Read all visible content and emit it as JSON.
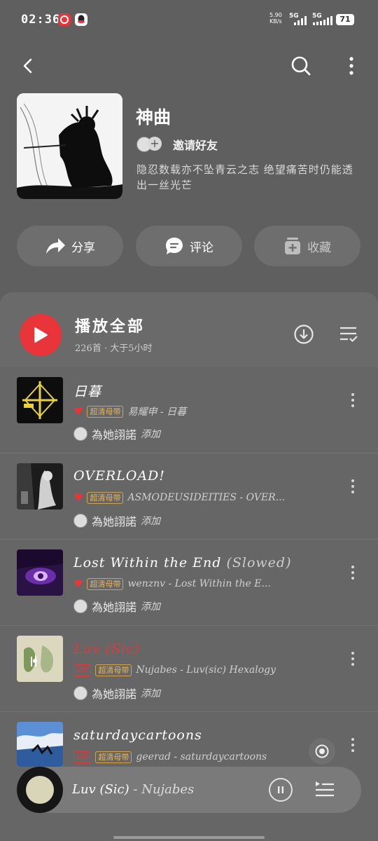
{
  "status_bar": {
    "time": "02:36",
    "net_speed": "5.90",
    "net_unit": "KB/s",
    "sim1": "5G",
    "sim2": "5G",
    "battery": "71"
  },
  "header": {
    "back_icon": "chevron-left-icon",
    "search_icon": "search-icon",
    "more_icon": "more-vertical-icon"
  },
  "playlist": {
    "title": "神曲",
    "invite_label": "邀请好友",
    "description": "隐忍数载亦不坠青云之志 绝望痛苦时仍能透出一丝光芒"
  },
  "actions": [
    {
      "label": "分享",
      "icon": "share-icon"
    },
    {
      "label": "评论",
      "icon": "comment-icon"
    },
    {
      "label": "收藏",
      "icon": "collect-icon"
    }
  ],
  "list_header": {
    "play_all": "播放全部",
    "count": "226首 · 大于5小时",
    "download_icon": "download-icon",
    "multiselect_icon": "list-check-icon"
  },
  "songs": [
    {
      "title": "日暮",
      "version": "",
      "tag": "超清母带",
      "vip": "",
      "info": "易耀申 - 日暮",
      "added_by": "為她詡諾",
      "added_verb": "添加",
      "liked": true,
      "playing": false
    },
    {
      "title": "OVERLOAD!",
      "version": "",
      "tag": "超清母带",
      "vip": "",
      "info": "ASMODEUSIDEITIES - OVER...",
      "added_by": "為她詡諾",
      "added_verb": "添加",
      "liked": true,
      "playing": false
    },
    {
      "title": "Lost Within the End",
      "version": "(Slowed)",
      "tag": "超清母带",
      "vip": "",
      "info": "wenznv - Lost Within the E...",
      "added_by": "為她詡諾",
      "added_verb": "添加",
      "liked": true,
      "playing": false
    },
    {
      "title": "Luv (Sic)",
      "version": "",
      "tag": "超清母带",
      "vip": "VIP",
      "info": "Nujabes - Luv(sic) Hexalogy",
      "added_by": "為她詡諾",
      "added_verb": "添加",
      "liked": false,
      "playing": true
    },
    {
      "title": "saturdaycartoons",
      "version": "",
      "tag": "超清母带",
      "vip": "VIP",
      "info": "geerad - saturdaycartoons",
      "added_by": "",
      "added_verb": "",
      "liked": false,
      "playing": false
    }
  ],
  "now_playing": {
    "title": "Luv (Sic)",
    "separator": "-",
    "artist": "Nujabes",
    "pause_icon": "pause-icon",
    "queue_icon": "playlist-icon",
    "locate_icon": "locate-icon"
  },
  "colors": {
    "accent": "#e8353a",
    "tag_gold": "#d4a34a",
    "background": "#5f5f5f"
  }
}
